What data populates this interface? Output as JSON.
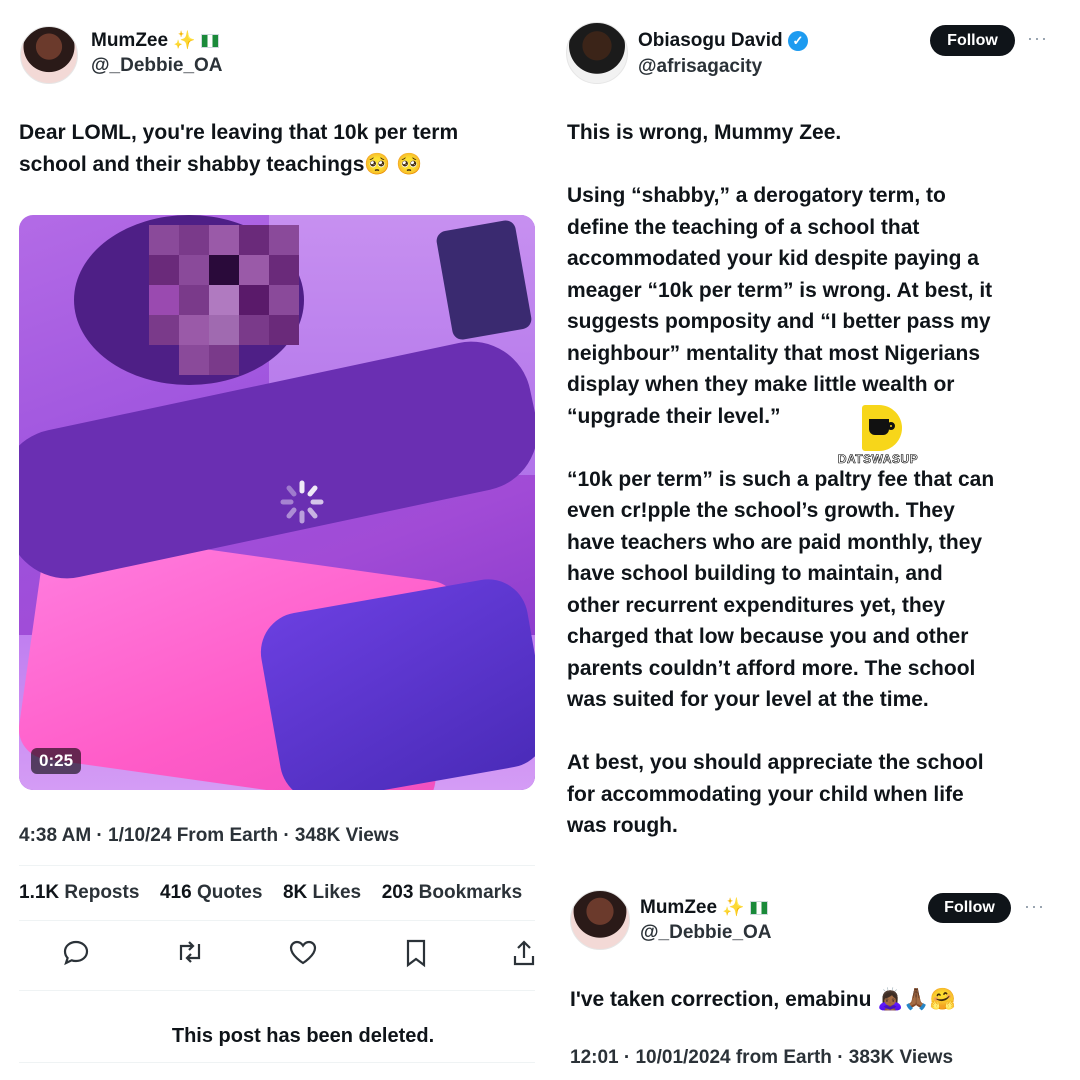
{
  "left_post": {
    "author_name": "MumZee",
    "author_handle": "@_Debbie_OA",
    "text_line1": "Dear LOML, you're leaving that 10k per term",
    "text_line2": "school and their shabby teachings🥺 🥺",
    "video_duration": "0:25",
    "meta": "4:38 AM · 1/10/24 From Earth · 348K Views",
    "stats": {
      "reposts_num": "1.1K",
      "reposts_label": "Reposts",
      "quotes_num": "416",
      "quotes_label": "Quotes",
      "likes_num": "8K",
      "likes_label": "Likes",
      "bookmarks_num": "203",
      "bookmarks_label": "Bookmarks"
    },
    "deleted_notice": "This post has been deleted."
  },
  "right_post": {
    "author_name": "Obiasogu David",
    "author_handle": "@afrisagacity",
    "follow_label": "Follow",
    "more": "···",
    "lines": [
      "This is wrong, Mummy Zee.",
      "",
      "Using “shabby,” a derogatory term, to",
      "define the teaching of a school that",
      "accommodated your kid despite paying a",
      "meager “10k per term” is wrong. At best, it",
      "suggests pomposity and “I better pass my",
      "neighbour” mentality that most Nigerians",
      "display when they make little wealth or",
      "“upgrade their level.”",
      "",
      "“10k per term” is such a paltry fee that can",
      "even cr!pple the school’s growth. They",
      "have teachers who are paid monthly, they",
      "have school building to maintain, and",
      "other recurrent expenditures yet, they",
      "charged that low because you and other",
      "parents couldn’t afford more. The school",
      "was suited for your level at the time.",
      "",
      "At best, you should appreciate the school",
      "for accommodating your child when life",
      "was rough."
    ]
  },
  "reply_post": {
    "author_name": "MumZee",
    "author_handle": "@_Debbie_OA",
    "follow_label": "Follow",
    "more": "···",
    "text": "I've taken correction, emabinu 🙇🏾‍♀️🙏🏾🤗",
    "meta": "12:01 · 10/01/2024 from Earth · 383K Views"
  },
  "watermark": {
    "text": "DATSWASUP"
  },
  "colors": {
    "accent": "#1d9bf0",
    "text": "#0f1419",
    "follow_bg": "#0f1419"
  },
  "icons": [
    "reply-icon",
    "repost-icon",
    "like-icon",
    "bookmark-icon",
    "share-icon"
  ]
}
